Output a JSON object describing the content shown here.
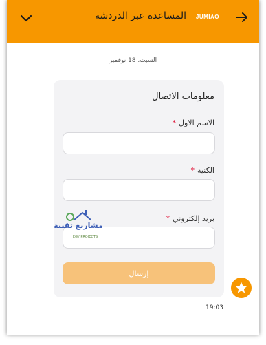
{
  "header": {
    "title": "المساعدة عبر الدردشة",
    "brand": "JUMIAO",
    "back_icon": "arrow-right-icon",
    "collapse_icon": "chevron-down-icon"
  },
  "chat": {
    "date": "السبت، 18 نوفمبر",
    "time": "19:03"
  },
  "form": {
    "title": "معلومات الاتصال",
    "required_mark": "*",
    "fields": [
      {
        "label": "الاسم الاول",
        "value": "",
        "placeholder": ""
      },
      {
        "label": "الكنية",
        "value": "",
        "placeholder": ""
      },
      {
        "label": "بريد إلكتروني",
        "value": "",
        "placeholder": ""
      }
    ],
    "submit_label": "إرسال"
  },
  "watermark": {
    "text": "مشاريع تقنية",
    "sub": "EGY PROJECTS"
  },
  "fab": {
    "icon": "star-icon"
  },
  "colors": {
    "brand_orange": "#f79700",
    "button_disabled": "#f7c27a",
    "card_bg": "#f3f3f5",
    "required": "#e0173a"
  }
}
